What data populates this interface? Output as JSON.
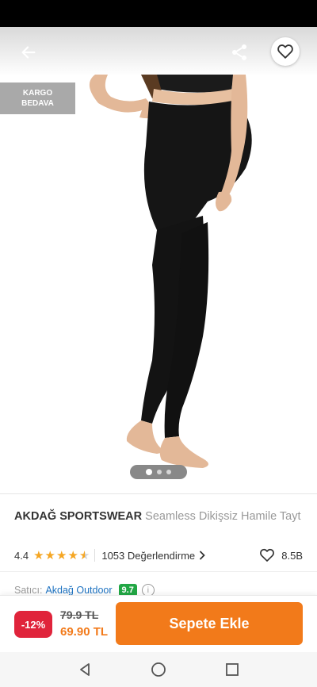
{
  "badge": {
    "line1": "KARGO",
    "line2": "BEDAVA"
  },
  "product": {
    "brand": "AKDAĞ SPORTSWEAR",
    "name": "Seamless Dikişsiz Hamile Tayt"
  },
  "rating": {
    "value": "4.4",
    "stars_filled": 4.4,
    "reviews": "1053 Değerlendirme"
  },
  "favorites": {
    "count": "8.5B"
  },
  "seller": {
    "label": "Satıcı:",
    "name": "Akdağ Outdoor",
    "score": "9.7"
  },
  "price": {
    "discount": "-12%",
    "old": "79.9 TL",
    "new": "69.90 TL"
  },
  "cta": {
    "add_to_cart": "Sepete Ekle"
  },
  "gallery": {
    "total": 3,
    "current": 1
  },
  "colors": {
    "accent": "#f27a1a",
    "discount": "#e0243b",
    "seller_link": "#1d72c1",
    "score_bg": "#22a745",
    "star": "#f5a623"
  },
  "icons": {
    "back": "arrow-left-icon",
    "share": "share-icon",
    "favorite": "heart-outline-icon",
    "info": "info-icon"
  }
}
